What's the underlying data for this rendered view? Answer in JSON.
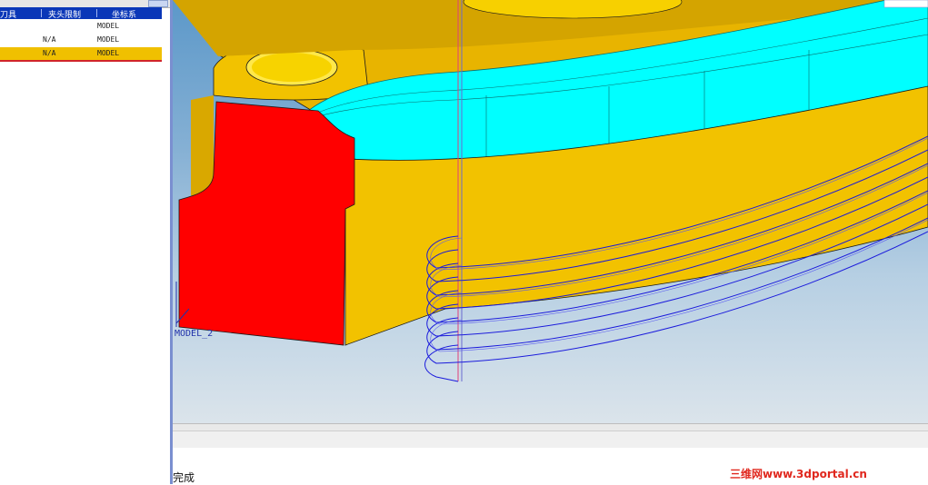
{
  "panel": {
    "headers": [
      "刀具",
      "夹头限制",
      "坐标系"
    ],
    "rows": [
      {
        "clamp": "",
        "csys": "MODEL",
        "selected": false
      },
      {
        "clamp": "N/A",
        "csys": "MODEL",
        "selected": false
      },
      {
        "clamp": "N/A",
        "csys": "MODEL",
        "selected": true
      }
    ]
  },
  "viewport": {
    "csys_label": "MODEL_2"
  },
  "message": {
    "text": "完成"
  },
  "watermark": "三维网www.3dportal.cn",
  "colors": {
    "header_bg": "#0a37b8",
    "selected_row": "#f0c000",
    "part_gold": "#e8b400",
    "part_cyan": "#00ffff",
    "part_red": "#ff0000",
    "toolpath": "#1a1adc",
    "tool_axis": "#e0407a"
  }
}
